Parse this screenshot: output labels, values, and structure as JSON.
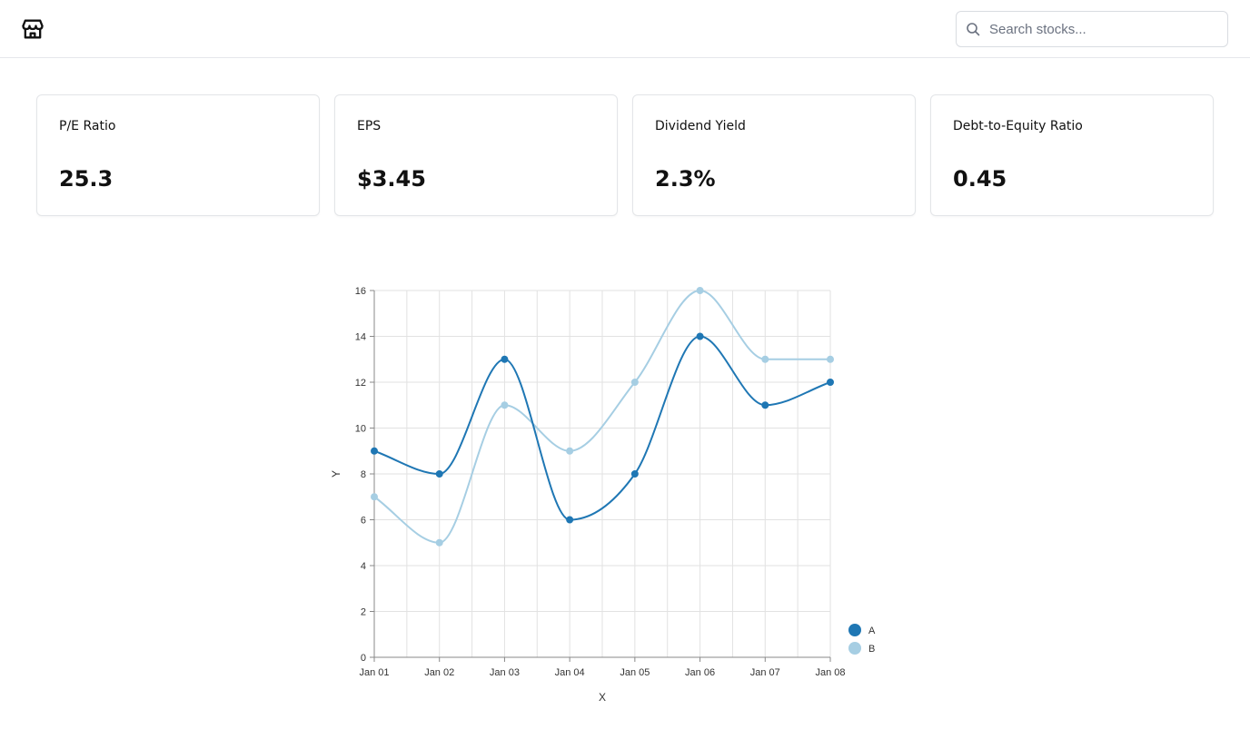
{
  "header": {
    "logo_icon": "store-icon",
    "search": {
      "placeholder": "Search stocks...",
      "value": "",
      "icon": "search-icon"
    }
  },
  "metrics": [
    {
      "label": "P/E Ratio",
      "value": "25.3"
    },
    {
      "label": "EPS",
      "value": "$3.45"
    },
    {
      "label": "Dividend Yield",
      "value": "2.3%"
    },
    {
      "label": "Debt-to-Equity Ratio",
      "value": "0.45"
    }
  ],
  "chart_data": {
    "type": "line",
    "title": "",
    "xlabel": "X",
    "ylabel": "Y",
    "x": [
      "Jan 01",
      "Jan 02",
      "Jan 03",
      "Jan 04",
      "Jan 05",
      "Jan 06",
      "Jan 07",
      "Jan 08"
    ],
    "series": [
      {
        "name": "A",
        "color": "#1f77b4",
        "values": [
          9,
          8,
          13,
          6,
          8,
          14,
          11,
          12
        ]
      },
      {
        "name": "B",
        "color": "#a6cee3",
        "values": [
          7,
          5,
          11,
          9,
          12,
          16,
          13,
          13
        ]
      }
    ],
    "ylim": [
      0,
      16
    ],
    "yticks": [
      0,
      2,
      4,
      6,
      8,
      10,
      12,
      14,
      16
    ],
    "grid": true,
    "curve": "smooth",
    "legend": "bottom-right"
  }
}
